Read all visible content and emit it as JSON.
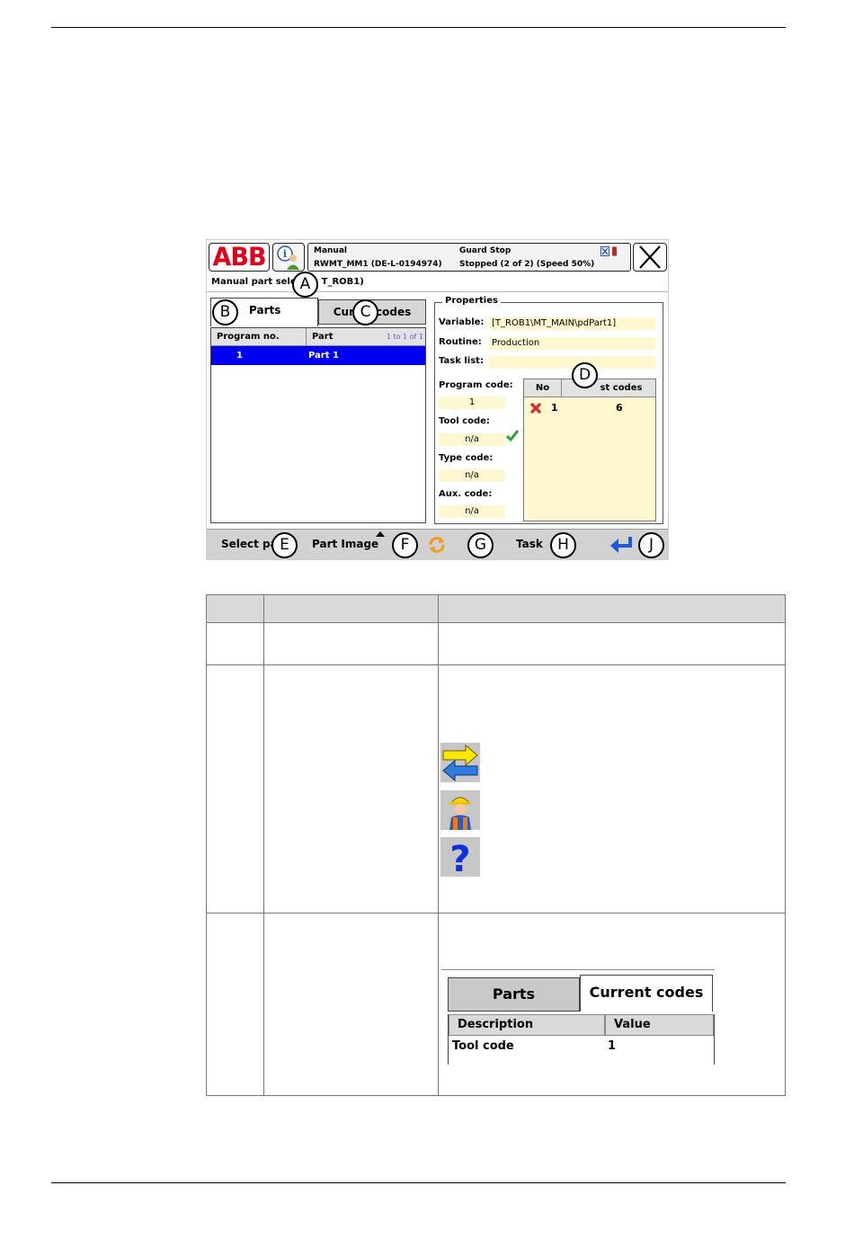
{
  "screen": {
    "logo": "ABB",
    "status": {
      "mode": "Manual",
      "controller": "RWMT_MM1 (DE-L-0194974)",
      "safety": "Guard Stop",
      "state": "Stopped (2 of 2) (Speed 50%)"
    },
    "window_title": "Manual part sele",
    "window_title_tail": "T_ROB1)",
    "tabs": {
      "parts": "Parts",
      "current_codes_a": "Cur",
      "current_codes_b": "codes"
    },
    "parts_table": {
      "headers": [
        "Program no.",
        "Part"
      ],
      "counter": "1 to 1 of 1",
      "rows": [
        {
          "program_no": "1",
          "part": "Part 1"
        }
      ]
    },
    "properties": {
      "title": "Properties",
      "variable_label": "Variable:",
      "variable_value": "[T_ROB1\\MT_MAIN\\pdPart1]",
      "routine_label": "Routine:",
      "routine_value": "Production",
      "tasklist_label": "Task list:",
      "tasklist_value": "",
      "program_code_label": "Program code:",
      "program_code_value": "1",
      "tool_code_label": "Tool code:",
      "tool_code_value": "n/a",
      "type_code_label": "Type code:",
      "type_code_value": "n/a",
      "aux_code_label": "Aux. code:",
      "aux_code_value": "n/a"
    },
    "codes_table": {
      "col_no": "No",
      "col_codes": "st codes",
      "rows": [
        {
          "no": "1",
          "value": "6"
        }
      ]
    },
    "command_bar": {
      "select": "Select pa",
      "part_image": "Part Image",
      "task": "Task"
    },
    "callouts": [
      "A",
      "B",
      "C",
      "D",
      "E",
      "F",
      "G",
      "H",
      "J"
    ]
  },
  "doc_table_icons": [
    "swap-arrows-icon",
    "operator-worker-icon",
    "question-mark-icon"
  ],
  "mini_screen": {
    "tab_parts": "Parts",
    "tab_current_codes": "Current codes",
    "col_description": "Description",
    "col_value": "Value",
    "row_description": "Tool code",
    "row_value": "1"
  },
  "colors": {
    "abb_red": "#e2001a",
    "selection_blue": "#0000f0",
    "value_field": "#fff7d0",
    "header_gray": "#d9d9d9"
  }
}
